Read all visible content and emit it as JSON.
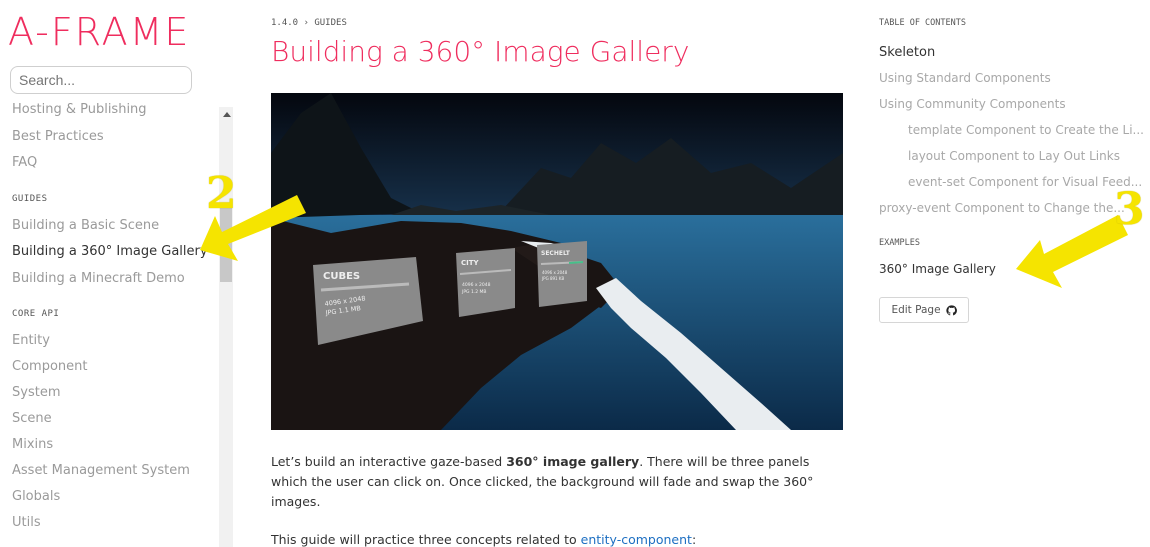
{
  "logo": "A-FRAME",
  "search": {
    "placeholder": "Search..."
  },
  "sidebar": {
    "items_top": [
      "Hosting & Publishing",
      "Best Practices",
      "FAQ"
    ],
    "guides_heading": "GUIDES",
    "guides": [
      "Building a Basic Scene",
      "Building a 360° Image Gallery",
      "Building a Minecraft Demo"
    ],
    "active_guide_index": 1,
    "core_heading": "CORE API",
    "core": [
      "Entity",
      "Component",
      "System",
      "Scene",
      "Mixins",
      "Asset Management System",
      "Globals",
      "Utils"
    ]
  },
  "main": {
    "breadcrumb": "1.4.0 › GUIDES",
    "title": "Building a 360° Image Gallery",
    "hero": {
      "panels": [
        {
          "title": "CUBES",
          "line1": "4096 x 2048",
          "line2": "JPG 1.1 MB"
        },
        {
          "title": "CITY",
          "line1": "4096 x 2048",
          "line2": "JPG 1.2 MB"
        },
        {
          "title": "SECHELT",
          "line1": "4096 x 2048",
          "line2": "JPG 891 KB"
        }
      ]
    },
    "para1_a": "Let’s build an interactive gaze-based ",
    "para1_b": "360° image gallery",
    "para1_c": ". There will be three panels",
    "para1_line2": "which the user can click on. Once clicked, the background will fade and swap the 360°",
    "para1_line3": "images.",
    "para2_a": "This guide will practice three concepts related to ",
    "para2_link": "entity-component",
    "para2_b": ":"
  },
  "toc": {
    "heading": "TABLE OF CONTENTS",
    "items": [
      {
        "label": "Skeleton",
        "indent": false,
        "active": true
      },
      {
        "label": "Using Standard Components",
        "indent": false,
        "active": false
      },
      {
        "label": "Using Community Components",
        "indent": false,
        "active": false
      },
      {
        "label": "template Component to Create the Li...",
        "indent": true,
        "active": false
      },
      {
        "label": "layout Component to Lay Out Links",
        "indent": true,
        "active": false
      },
      {
        "label": "event-set Component for Visual Feed...",
        "indent": true,
        "active": false
      },
      {
        "label": "proxy-event Component to Change the...",
        "indent": false,
        "active": false
      }
    ],
    "examples_heading": "EXAMPLES",
    "example": "360° Image Gallery",
    "edit_label": "Edit Page"
  },
  "annotations": {
    "num2": "2",
    "num3": "3",
    "color": "#f5e400"
  },
  "colors": {
    "brand": "#ef2d5e",
    "link": "#1d6fc2"
  }
}
